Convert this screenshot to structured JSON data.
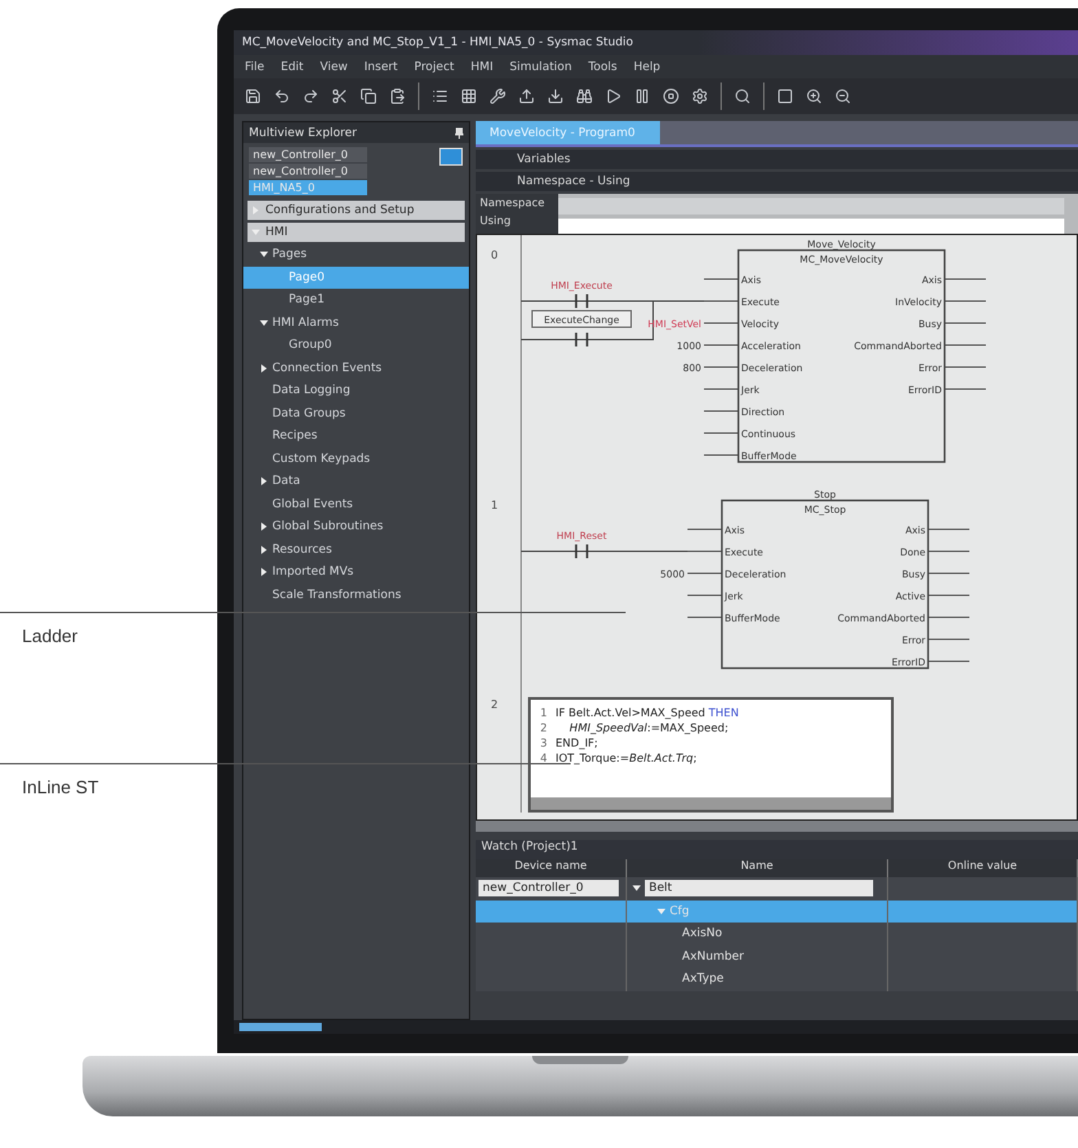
{
  "callouts": [
    {
      "label": "Ladder"
    },
    {
      "label": "InLine ST"
    }
  ],
  "window": {
    "title": "MC_MoveVelocity and MC_Stop_V1_1 - HMI_NA5_0 - Sysmac Studio"
  },
  "menu": [
    "File",
    "Edit",
    "View",
    "Insert",
    "Project",
    "HMI",
    "Simulation",
    "Tools",
    "Help"
  ],
  "explorer": {
    "title": "Multiview Explorer",
    "devices": [
      {
        "label": "new_Controller_0",
        "selected": false
      },
      {
        "label": "new_Controller_0",
        "selected": false
      },
      {
        "label": "HMI_NA5_0",
        "selected": true
      }
    ],
    "sections": [
      {
        "label": "Configurations and Setup",
        "expanded": false
      },
      {
        "label": "HMI",
        "expanded": true
      }
    ],
    "tree": [
      {
        "label": "Pages",
        "expanded": true,
        "selected": false,
        "children": [
          {
            "label": "Page0",
            "selected": true
          },
          {
            "label": "Page1",
            "selected": false
          }
        ]
      },
      {
        "label": "HMI Alarms",
        "expanded": true,
        "selected": false,
        "children": [
          {
            "label": "Group0",
            "selected": false
          }
        ]
      },
      {
        "label": "Connection Events",
        "expanded": false,
        "selected": false
      },
      {
        "label": "Data Logging",
        "selected": false
      },
      {
        "label": "Data Groups",
        "selected": false
      },
      {
        "label": "Recipes",
        "selected": false
      },
      {
        "label": "Custom Keypads",
        "selected": false
      },
      {
        "label": "Data",
        "expanded": false,
        "selected": false
      },
      {
        "label": "Global Events",
        "selected": false
      },
      {
        "label": "Global Subroutines",
        "expanded": false,
        "selected": false
      },
      {
        "label": "Resources",
        "expanded": false,
        "selected": false
      },
      {
        "label": "Imported MVs",
        "expanded": false,
        "selected": false
      },
      {
        "label": "Scale Transformations",
        "selected": false
      }
    ]
  },
  "editor": {
    "tab": "MoveVelocity - Program0",
    "variables": "Variables",
    "namespace_bar": "Namespace - Using",
    "namespace_label": "Namespace",
    "using_label": "Using",
    "rungs": [
      {
        "kind": "fb",
        "number": "0",
        "contacts": [
          {
            "label": "HMI_Execute",
            "boxed": false
          },
          {
            "label": "ExecuteChange",
            "boxed": true
          }
        ],
        "instance": "Move_Velocity",
        "fb": "MC_MoveVelocity",
        "inputs": [
          {
            "pin": "Axis"
          },
          {
            "pin": "Execute"
          },
          {
            "pin": "Velocity",
            "value": "HMI_SetVel",
            "highlight": true
          },
          {
            "pin": "Acceleration",
            "value": "1000",
            "highlight": false
          },
          {
            "pin": "Deceleration",
            "value": "800",
            "highlight": false
          },
          {
            "pin": "Jerk"
          },
          {
            "pin": "Direction"
          },
          {
            "pin": "Continuous"
          },
          {
            "pin": "BufferMode"
          }
        ],
        "outputs": [
          {
            "pin": "Axis"
          },
          {
            "pin": "InVelocity"
          },
          {
            "pin": "Busy"
          },
          {
            "pin": "CommandAborted"
          },
          {
            "pin": "Error"
          },
          {
            "pin": "ErrorID"
          }
        ]
      },
      {
        "kind": "fb",
        "number": "1",
        "contacts": [
          {
            "label": "HMI_Reset",
            "boxed": false
          }
        ],
        "instance": "Stop",
        "fb": "MC_Stop",
        "inputs": [
          {
            "pin": "Axis"
          },
          {
            "pin": "Execute"
          },
          {
            "pin": "Deceleration",
            "value": "5000",
            "highlight": false
          },
          {
            "pin": "Jerk"
          },
          {
            "pin": "BufferMode"
          }
        ],
        "outputs": [
          {
            "pin": "Axis"
          },
          {
            "pin": "Done"
          },
          {
            "pin": "Busy"
          },
          {
            "pin": "Active"
          },
          {
            "pin": "CommandAborted"
          },
          {
            "pin": "Error"
          },
          {
            "pin": "ErrorID"
          }
        ]
      },
      {
        "kind": "st",
        "number": "2",
        "lines": [
          {
            "no": "1",
            "code": "IF Belt.Act.Vel>MAX_Speed **THEN**"
          },
          {
            "no": "2",
            "code": "    *HMI_SpeedVal*:=MAX_Speed;"
          },
          {
            "no": "3",
            "code": "END_IF;"
          },
          {
            "no": "4",
            "code": "IOT_Torque:=*Belt.Act.Trq*;"
          }
        ]
      }
    ]
  },
  "watch": {
    "title": "Watch (Project)1",
    "columns": [
      "Device name",
      "Name",
      "Online value"
    ],
    "rows": [
      {
        "device": "new_Controller_0",
        "name": "Belt",
        "expanded": true,
        "selected": false,
        "children": [
          {
            "name": "Cfg",
            "expanded": true,
            "selected": true,
            "children": [
              {
                "name": "AxisNo",
                "selected": false
              },
              {
                "name": "AxNumber",
                "selected": false
              },
              {
                "name": "AxType",
                "selected": false
              }
            ]
          }
        ]
      }
    ]
  }
}
